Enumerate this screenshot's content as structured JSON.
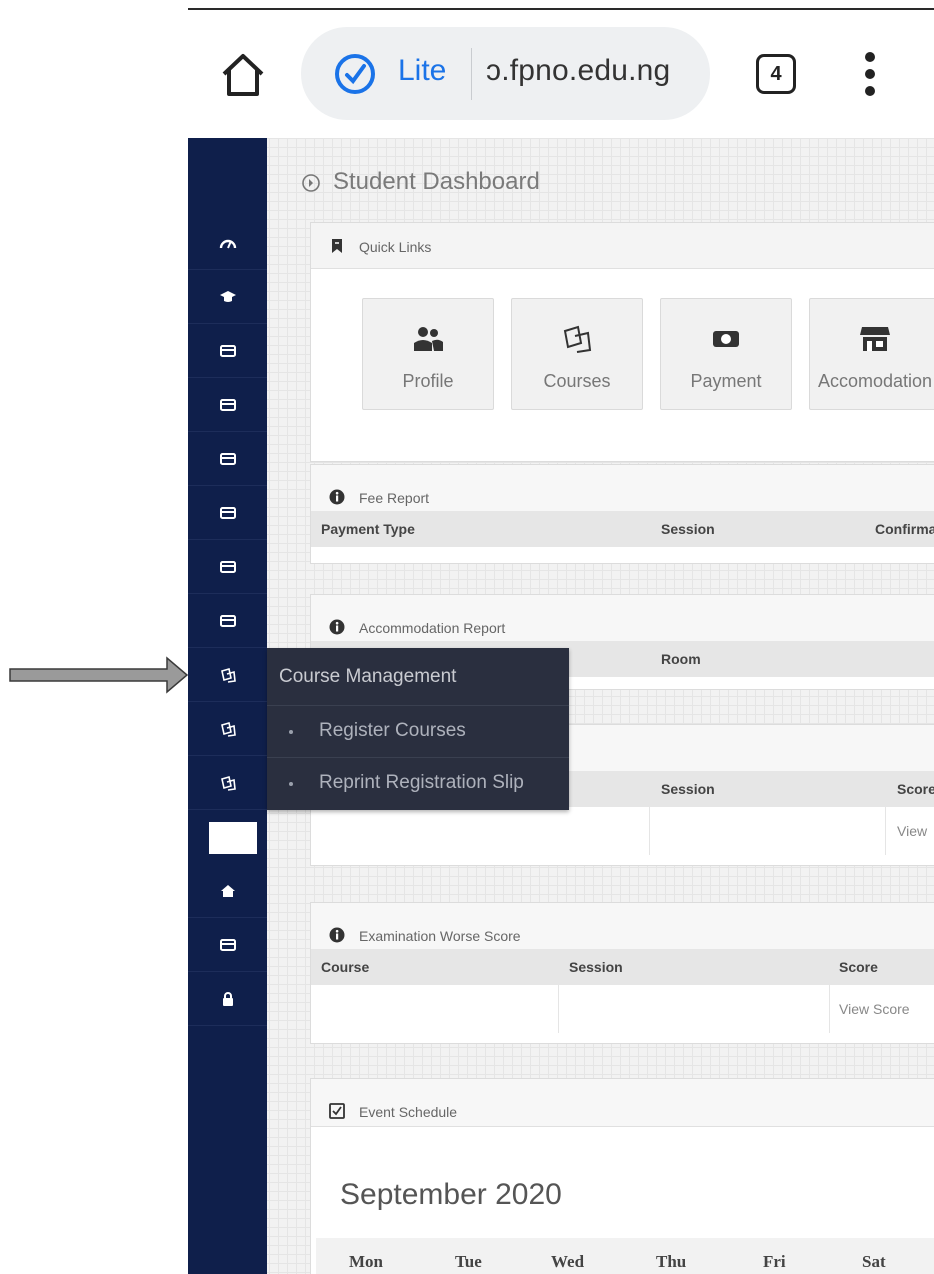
{
  "browser": {
    "mode_label": "Lite",
    "url": "ɔ.fpno.edu.ng",
    "tab_count": "4"
  },
  "page": {
    "title": "Student Dashboard"
  },
  "quick_links": {
    "title": "Quick Links",
    "tiles": [
      {
        "label": "Profile",
        "icon": "users-icon"
      },
      {
        "label": "Courses",
        "icon": "book-icon"
      },
      {
        "label": "Payment",
        "icon": "money-icon"
      },
      {
        "label": "Accomodation",
        "icon": "store-icon"
      }
    ]
  },
  "fee_report": {
    "title": "Fee Report",
    "columns": [
      "Payment Type",
      "Session",
      "Confirma"
    ]
  },
  "accommodation_report": {
    "title": "Accommodation Report",
    "columns": [
      "Room"
    ]
  },
  "course_report": {
    "columns": [
      "Session",
      "Score"
    ],
    "link": "View"
  },
  "exam_worse_score": {
    "title": "Examination Worse Score",
    "columns": [
      "Course",
      "Session",
      "Score"
    ],
    "link": "View Score"
  },
  "event_schedule": {
    "title": "Event Schedule",
    "month": "September 2020",
    "days": [
      "Mon",
      "Tue",
      "Wed",
      "Thu",
      "Fri",
      "Sat"
    ]
  },
  "flyout": {
    "title": "Course Management",
    "items": [
      "Register Courses",
      "Reprint Registration Slip"
    ]
  },
  "colors": {
    "sidebar": "#0f1f4b",
    "flyout": "#2a2f3f",
    "accent": "#1a73e8"
  }
}
